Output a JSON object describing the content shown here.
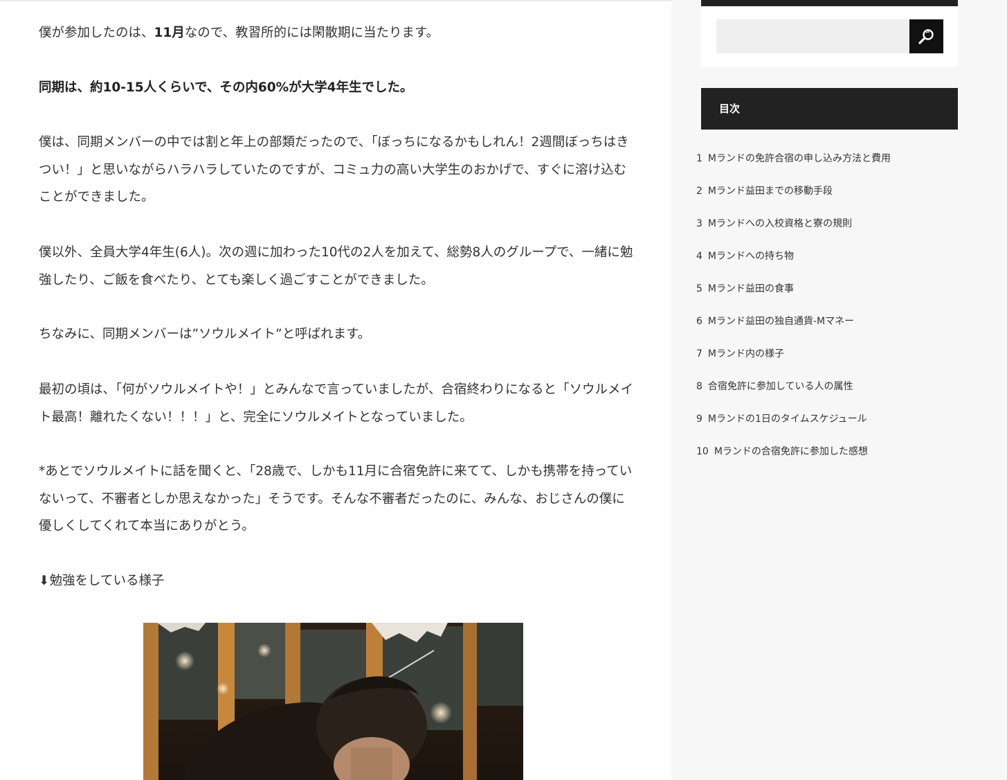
{
  "article": {
    "p1_before": "僕が参加したのは、",
    "p1_bold": "11月",
    "p1_after": "なので、教習所的には閑散期に当たります。",
    "p2": "同期は、約10-15人くらいで、その内60%が大学4年生でした。",
    "p3": "僕は、同期メンバーの中では割と年上の部類だったので、「ぼっちになるかもしれん！2週間ぼっちはきつい！」と思いながらハラハラしていたのですが、コミュ力の高い大学生のおかげで、すぐに溶け込むことができました。",
    "p4": "僕以外、全員大学4年生(6人)。次の週に加わった10代の2人を加えて、総勢8人のグループで、一緒に勉強したり、ご飯を食べたり、とても楽しく過ごすことができました。",
    "p5": "ちなみに、同期メンバーは”ソウルメイト”と呼ばれます。",
    "p6": "最初の頃は、「何がソウルメイトや！」とみんなで言っていましたが、合宿終わりになると「ソウルメイト最高！離れたくない！！！」と、完全にソウルメイトとなっていました。",
    "p7": "*あとでソウルメイトに話を聞くと、「28歳で、しかも11月に合宿免許に来てて、しかも携帯を持っていないって、不審者としか思えなかった」そうです。そんな不審者だったのに、みんな、おじさんの僕に優しくしてくれて本当にありがとう。",
    "p8": "⬇勉強をしている様子"
  },
  "sidebar": {
    "search_value": "",
    "search_button_icon": "search-icon",
    "toc_title": "目次",
    "toc": [
      {
        "num": "1",
        "label": "Mランドの免許合宿の申し込み方法と費用"
      },
      {
        "num": "2",
        "label": "Mランド益田までの移動手段"
      },
      {
        "num": "3",
        "label": "Mランドへの入校資格と寮の規則"
      },
      {
        "num": "4",
        "label": "Mランドへの持ち物"
      },
      {
        "num": "5",
        "label": "Mランド益田の食事"
      },
      {
        "num": "6",
        "label": "Mランド益田の独自通貨-Mマネー"
      },
      {
        "num": "7",
        "label": "Mランド内の様子"
      },
      {
        "num": "8",
        "label": "合宿免許に参加している人の属性"
      },
      {
        "num": "9",
        "label": "Mランドの1日のタイムスケジュール"
      },
      {
        "num": "10",
        "label": "Mランドの合宿免許に参加した感想"
      }
    ]
  },
  "colors": {
    "text": "#333333",
    "sidebar_bg": "#f7f7f7",
    "dark_header": "#222222",
    "search_button": "#111111"
  }
}
